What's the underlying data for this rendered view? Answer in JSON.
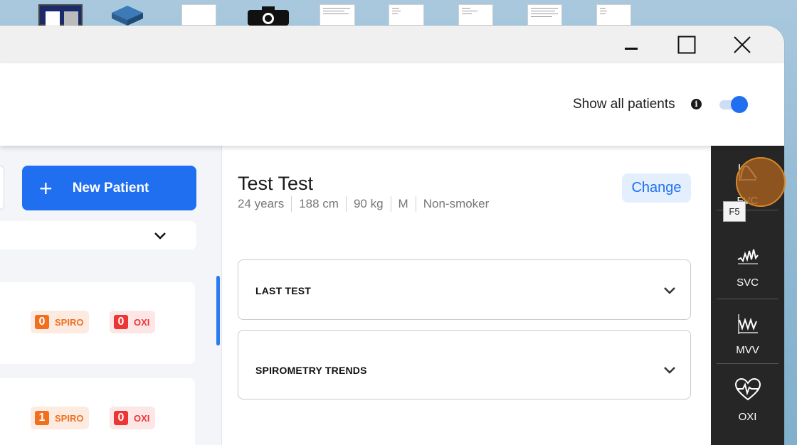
{
  "window": {
    "controls": {
      "minimize": "minimize",
      "maximize": "maximize",
      "close": "close"
    }
  },
  "header": {
    "show_all_label": "Show all patients",
    "info_icon": "i",
    "toggle_on": true
  },
  "sidebar": {
    "new_patient_label": "New Patient",
    "new_patient_icon": "+",
    "patients": [
      {
        "spiro_count": "0",
        "spiro_label": "SPIRO",
        "oxi_count": "0",
        "oxi_label": "OXI"
      },
      {
        "spiro_count": "1",
        "spiro_label": "SPIRO",
        "oxi_count": "0",
        "oxi_label": "OXI"
      }
    ]
  },
  "patient": {
    "name": "Test Test",
    "age": "24 years",
    "height": "188 cm",
    "weight": "90 kg",
    "sex": "M",
    "smoker": "Non-smoker",
    "change_label": "Change"
  },
  "sections": [
    {
      "title": "LAST TEST"
    },
    {
      "title": "SPIROMETRY TRENDS"
    }
  ],
  "rail": [
    {
      "label": "FVC",
      "icon": "fvc-curve-icon"
    },
    {
      "label": "SVC",
      "icon": "svc-wave-icon"
    },
    {
      "label": "MVV",
      "icon": "mvv-wave-icon"
    },
    {
      "label": "OXI",
      "icon": "heart-pulse-icon"
    }
  ],
  "tooltip": "F5",
  "colors": {
    "primary": "#1f6ff0",
    "spiro": "#f07020",
    "oxi": "#ee3535",
    "rail": "#262626"
  }
}
